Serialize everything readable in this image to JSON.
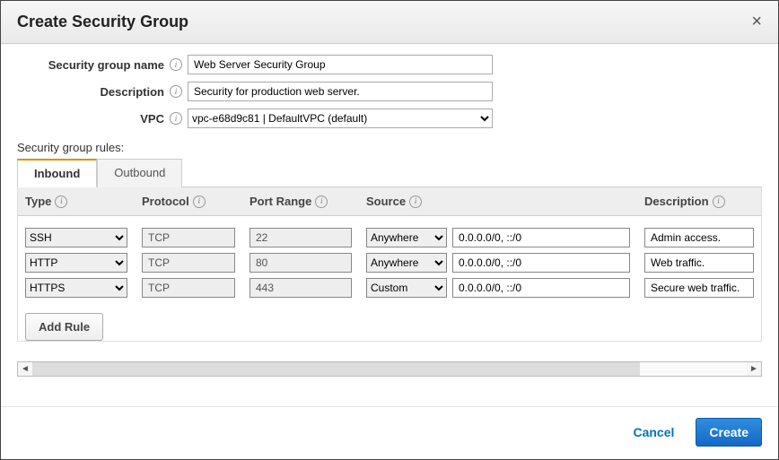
{
  "dialog": {
    "title": "Create Security Group",
    "close_label": "×"
  },
  "form": {
    "name_label": "Security group name",
    "name_value": "Web Server Security Group",
    "description_label": "Description",
    "description_value": "Security for production web server.",
    "vpc_label": "VPC",
    "vpc_value": "vpc-e68d9c81 | DefaultVPC (default)"
  },
  "rules_section": {
    "label": "Security group rules:",
    "tabs": [
      {
        "label": "Inbound",
        "active": true
      },
      {
        "label": "Outbound",
        "active": false
      }
    ],
    "headers": {
      "type": "Type",
      "protocol": "Protocol",
      "port": "Port Range",
      "source": "Source",
      "description": "Description"
    },
    "rows": [
      {
        "type": "SSH",
        "protocol": "TCP",
        "port": "22",
        "source_mode": "Anywhere",
        "source_cidr": "0.0.0.0/0, ::/0",
        "description": "Admin access."
      },
      {
        "type": "HTTP",
        "protocol": "TCP",
        "port": "80",
        "source_mode": "Anywhere",
        "source_cidr": "0.0.0.0/0, ::/0",
        "description": "Web traffic."
      },
      {
        "type": "HTTPS",
        "protocol": "TCP",
        "port": "443",
        "source_mode": "Custom",
        "source_cidr": "0.0.0.0/0, ::/0",
        "description": "Secure web traffic."
      }
    ],
    "add_rule_label": "Add Rule"
  },
  "footer": {
    "cancel_label": "Cancel",
    "create_label": "Create"
  }
}
